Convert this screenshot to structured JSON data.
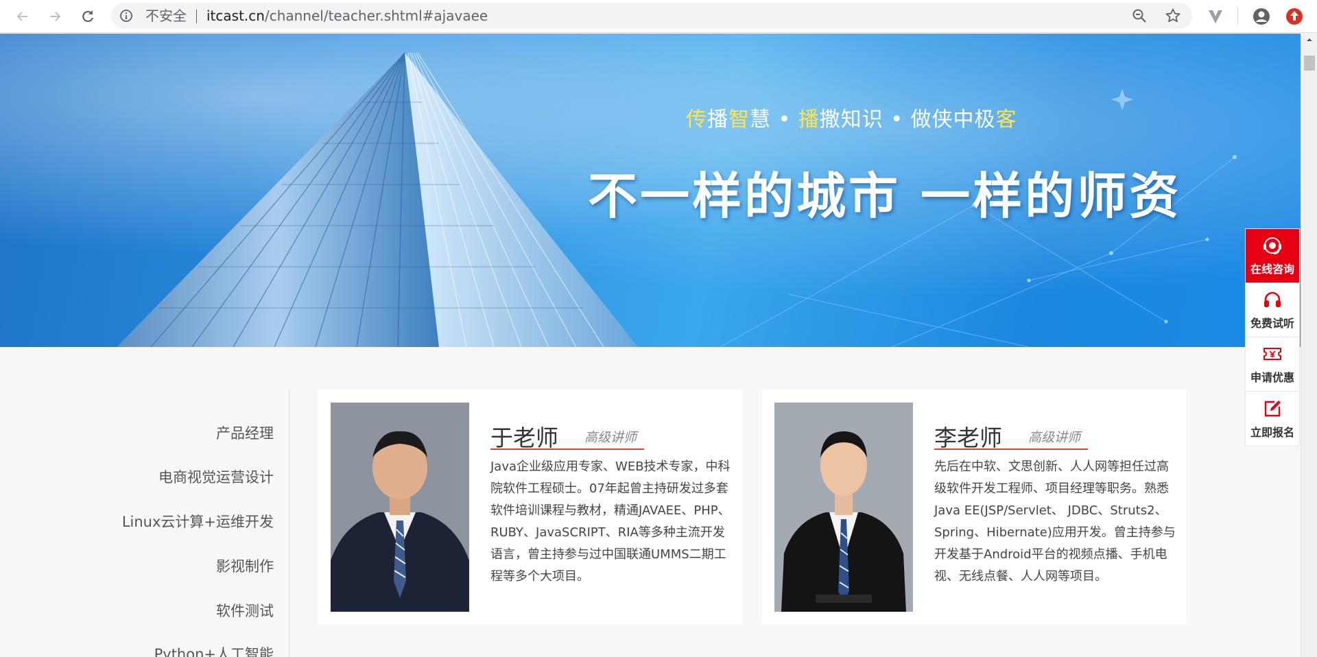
{
  "browser": {
    "security_label": "不安全",
    "url_host": "itcast.cn",
    "url_path": "/channel/teacher.shtml#ajavaee"
  },
  "banner": {
    "slogan_parts": [
      "传",
      "播",
      "智",
      "慧",
      " • ",
      "播",
      "撒知识",
      " • ",
      "做侠中极",
      "客"
    ],
    "headline": "不一样的城市  一样的师资"
  },
  "float_bar": {
    "items": [
      {
        "label": "在线咨询",
        "icon": "headset-chat-icon",
        "active": true
      },
      {
        "label": "免费试听",
        "icon": "headphones-icon",
        "active": false
      },
      {
        "label": "申请优惠",
        "icon": "coupon-icon",
        "active": false
      },
      {
        "label": "立即报名",
        "icon": "edit-icon",
        "active": false
      }
    ]
  },
  "side_nav": {
    "items": [
      "产品经理",
      "电商视觉运营设计",
      "Linux云计算+运维开发",
      "影视制作",
      "软件测试",
      "Python+人工智能"
    ]
  },
  "teachers": [
    {
      "name": "于老师",
      "title": "高级讲师",
      "description": "Java企业级应用专家、WEB技术专家，中科院软件工程硕士。07年起曾主持研发过多套软件培训课程与教材，精通JAVAEE、PHP、RUBY、JavaSCRIPT、RIA等多种主流开发语言，曾主持参与过中国联通UMMS二期工程等多个大项目。"
    },
    {
      "name": "李老师",
      "title": "高级讲师",
      "description": "先后在中软、文思创新、人人网等担任过高级软件开发工程师、项目经理等职务。熟悉Java EE(JSP/Servlet、 JDBC、Struts2、Spring、Hibernate)应用开发。曾主持参与开发基于Android平台的视频点播、手机电视、无线点餐、人人网等项目。"
    }
  ],
  "colors": {
    "accent_red": "#e60012",
    "banner_blue": "#2a8ee0",
    "slogan_highlight": "#ffe44d"
  }
}
